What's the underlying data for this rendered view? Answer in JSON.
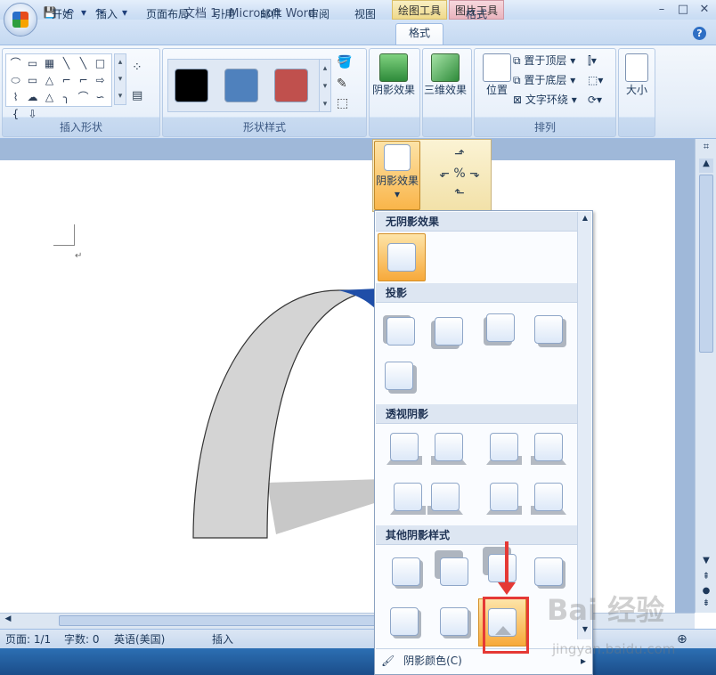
{
  "window": {
    "title": "文档 1 - Microsoft Word",
    "context_tabs": [
      "绘图工具",
      "图片工具"
    ],
    "minimize": "–",
    "maximize": "□",
    "close": "✕"
  },
  "qat": {
    "save": "💾",
    "undo": "↶",
    "redo": "↷",
    "more": "▾"
  },
  "tabs": [
    "开始",
    "插入",
    "页面布局",
    "引用",
    "邮件",
    "审阅",
    "视图",
    "格式",
    "格式"
  ],
  "help": "?",
  "ribbon": {
    "groups": {
      "insert_shapes": "插入形状",
      "shape_styles": "形状样式",
      "arrange": "排列"
    },
    "shape_cells": [
      "⌒",
      "▭",
      "▦",
      "╲",
      "╲",
      "□",
      "⬭",
      "▭",
      "△",
      "⌐",
      "⌐",
      "⇨",
      "⌇",
      "☁",
      "△",
      "╮",
      "⌒",
      "∽",
      "{",
      "⇩"
    ],
    "swatch_colors": [
      "#000000",
      "#4f81bd",
      "#c0504d"
    ],
    "shadow_effects": "阴影效果",
    "three_d_effects": "三维效果",
    "position": "位置",
    "bring_front": "置于顶层",
    "send_back": "置于底层",
    "text_wrap": "文字环绕",
    "size": "大小"
  },
  "gallery": {
    "shadow_button": "阴影效果",
    "sections": {
      "none": "无阴影效果",
      "drop": "投影",
      "perspective": "透视阴影",
      "other": "其他阴影样式"
    },
    "shadow_color": "阴影颜色(C)"
  },
  "status": {
    "page": "页面: 1/1",
    "words": "字数: 0",
    "language": "英语(美国)",
    "mode": "插入"
  },
  "watermark": {
    "logo": "Bai 经验",
    "url": "jingyan.baidu.com"
  },
  "colors": {
    "accent_orange": "#f7a93a",
    "highlight_red": "#e53935",
    "shape_gray": "#d4d4d4",
    "shape_blue": "#1f4ea8"
  }
}
